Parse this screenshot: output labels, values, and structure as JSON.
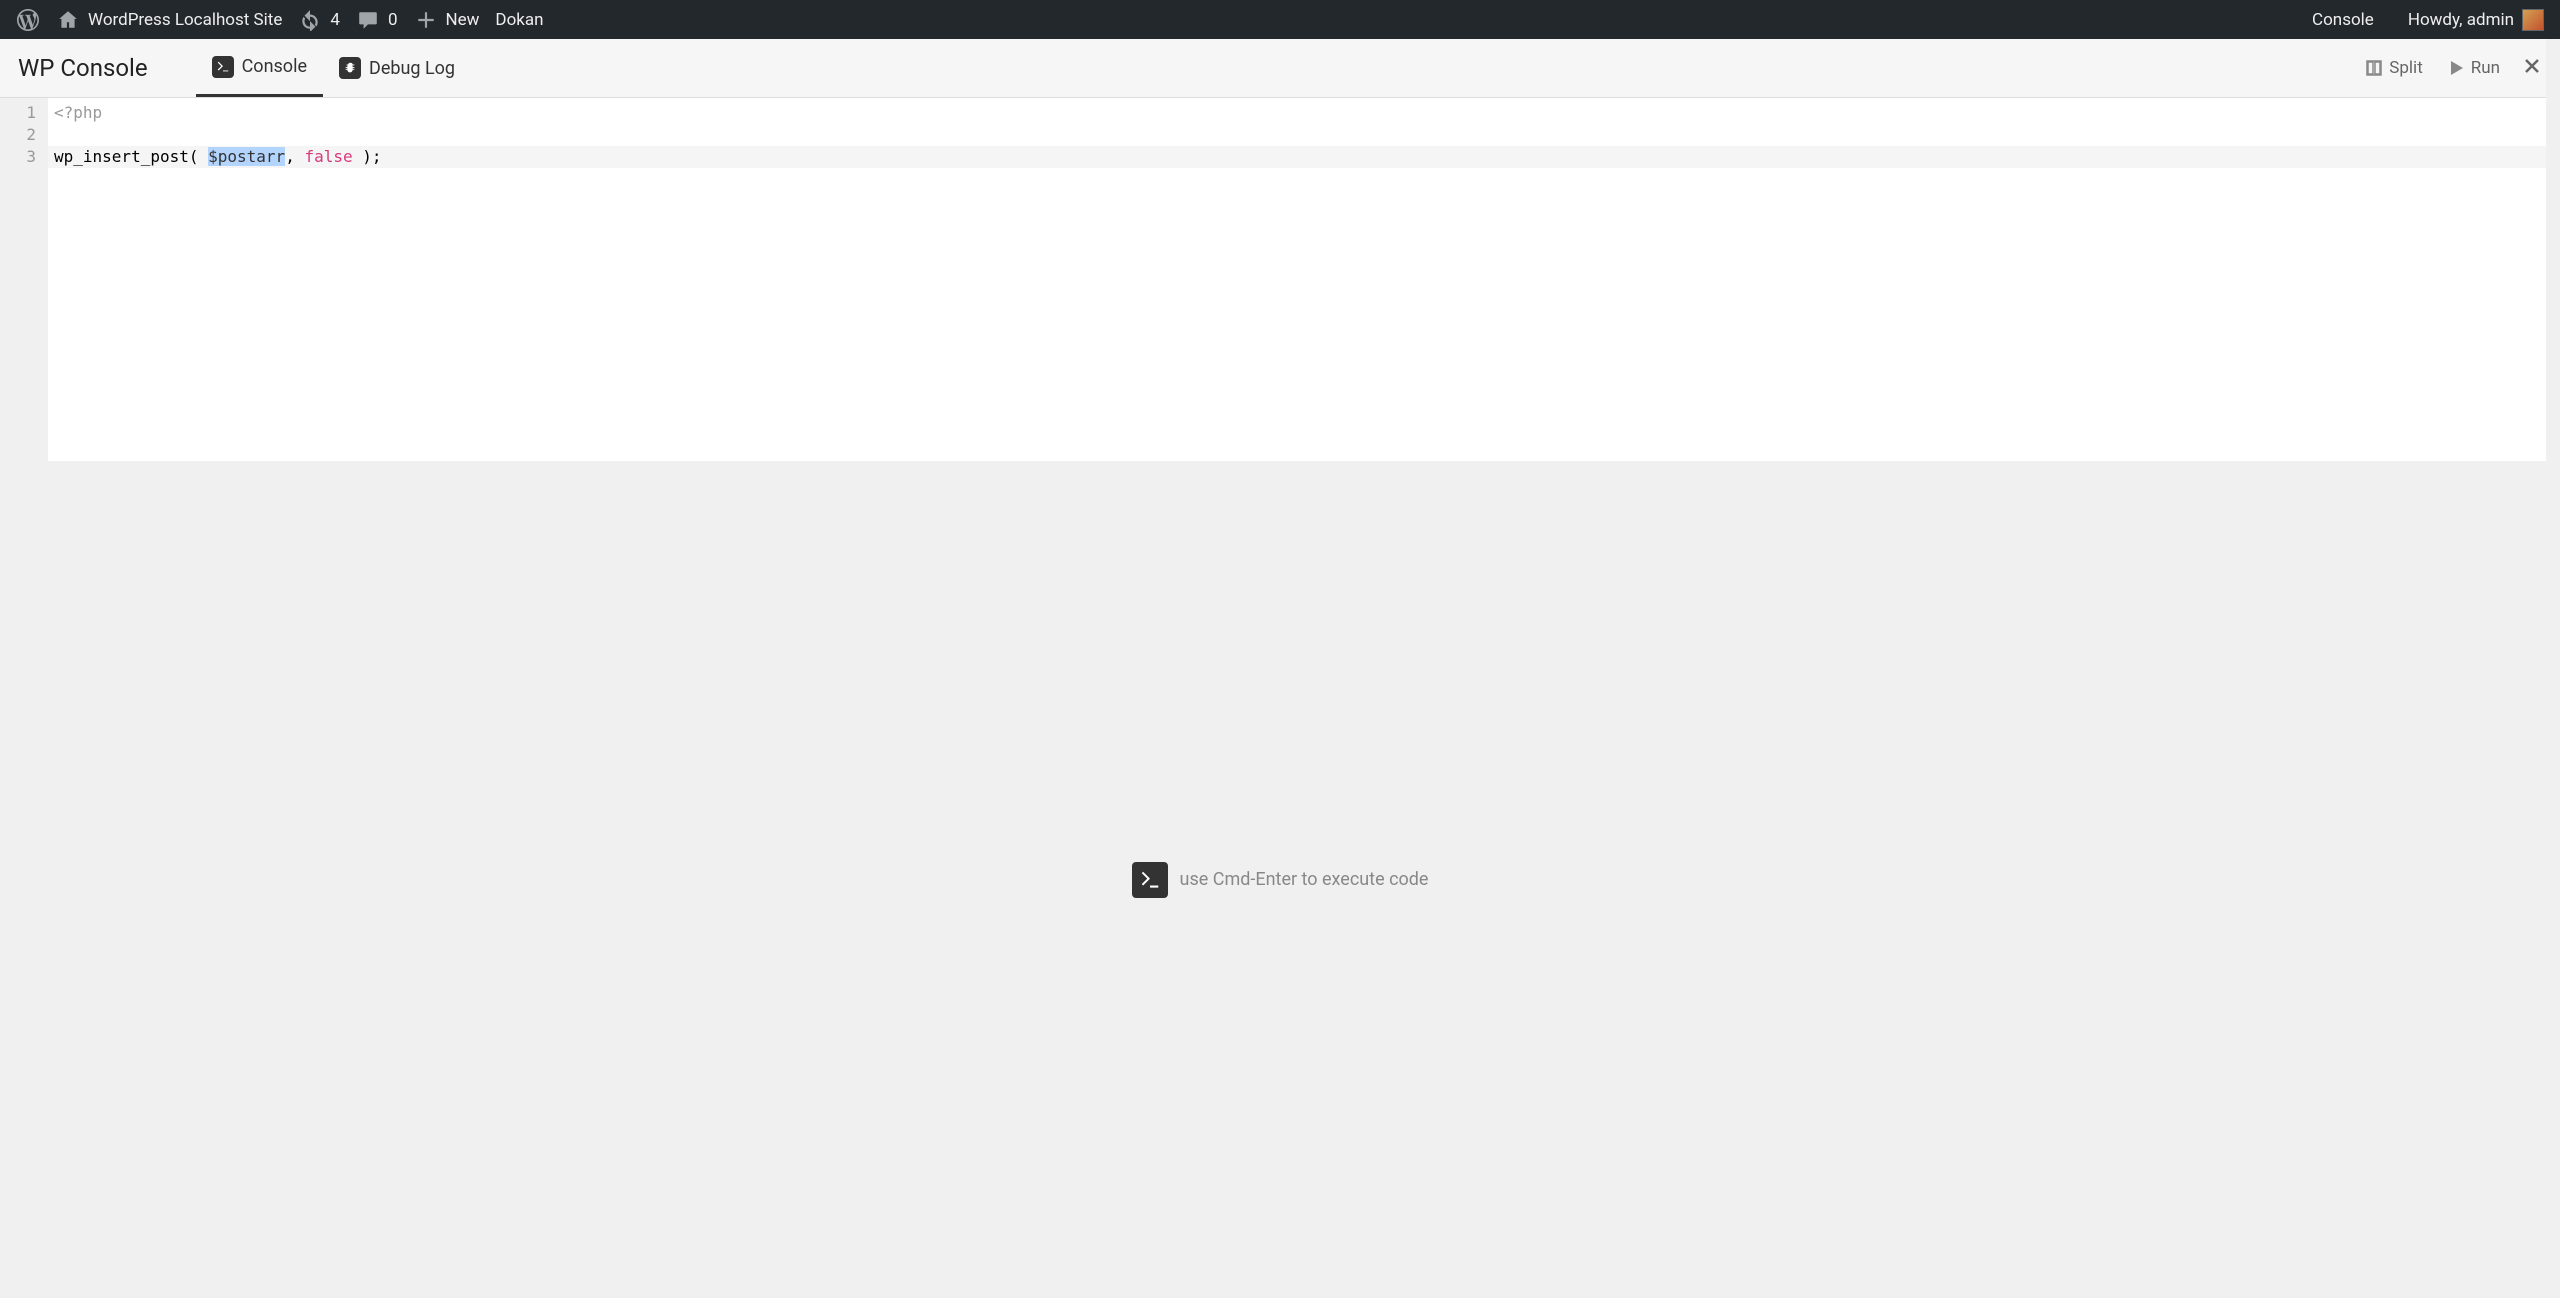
{
  "adminbar": {
    "site_name": "WordPress Localhost Site",
    "update_count": "4",
    "comment_count": "0",
    "new_label": "New",
    "dokan_label": "Dokan",
    "console_link": "Console",
    "howdy": "Howdy, admin"
  },
  "header": {
    "title": "WP Console",
    "tabs": [
      {
        "label": "Console",
        "active": true
      },
      {
        "label": "Debug Log",
        "active": false
      }
    ],
    "actions": {
      "split": "Split",
      "run": "Run"
    }
  },
  "editor": {
    "lines": [
      {
        "num": "1",
        "tokens": [
          {
            "t": "<?php",
            "cls": "tok-meta"
          }
        ]
      },
      {
        "num": "2",
        "tokens": []
      },
      {
        "num": "3",
        "current": true,
        "tokens": [
          {
            "t": "wp_insert_post( ",
            "cls": ""
          },
          {
            "t": "$postarr",
            "cls": "tok-var tok-sel"
          },
          {
            "t": ", ",
            "cls": ""
          },
          {
            "t": "false",
            "cls": "tok-keyword"
          },
          {
            "t": " );",
            "cls": ""
          }
        ]
      }
    ]
  },
  "hint": "use Cmd-Enter to execute code"
}
